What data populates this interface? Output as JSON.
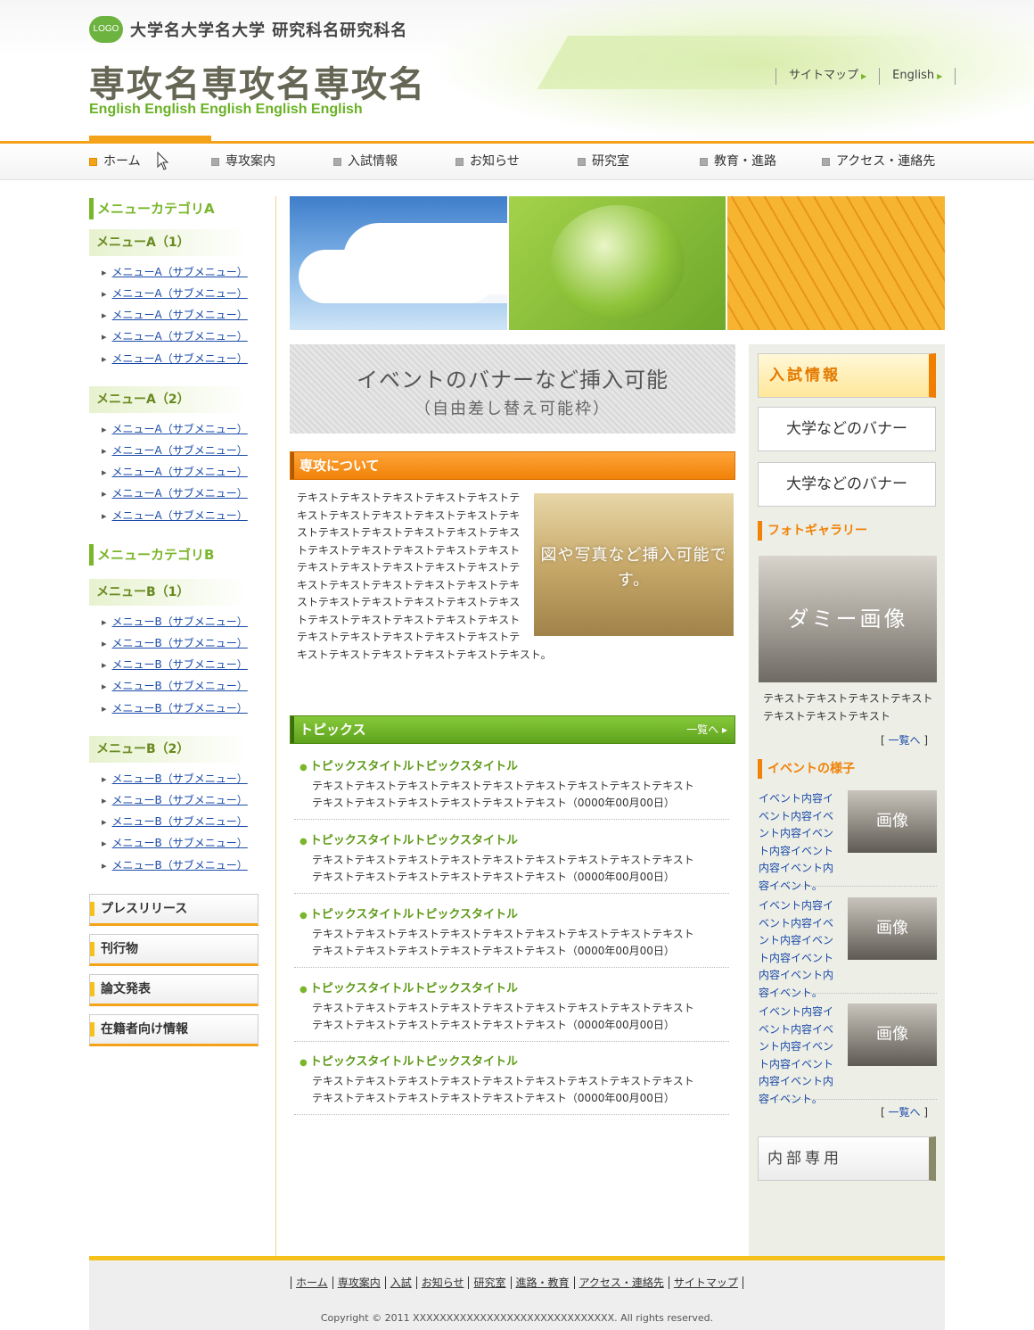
{
  "header": {
    "logo": "LOGO",
    "university": "大学名大学名大学 研究科名研究科名",
    "department": "専攻名専攻名専攻名",
    "department_en": "English English English English English",
    "toplinks": [
      "サイトマップ",
      "English"
    ]
  },
  "nav": {
    "items": [
      "ホーム",
      "専攻案内",
      "入試情報",
      "お知らせ",
      "研究室",
      "教育・進路",
      "アクセス・連絡先"
    ],
    "active": "ホーム"
  },
  "left": {
    "cat_a": "メニューカテゴリA",
    "cat_b": "メニューカテゴリB",
    "menu_a1": "メニューA（1）",
    "menu_a2": "メニューA（2）",
    "menu_b1": "メニューB（1）",
    "menu_b2": "メニューB（2）",
    "sub_a": "メニューA（サブメニュー）",
    "sub_b": "メニューB（サブメニュー）",
    "buttons": [
      "プレスリリース",
      "刊行物",
      "論文発表",
      "在籍者向け情報"
    ]
  },
  "main": {
    "event_banner": {
      "line1": "イベントのバナーなど挿入可能",
      "line2": "（自由差し替え可能枠）"
    },
    "about_title": "専攻について",
    "about_image_text": "図や写真など挿入可能です。",
    "about_text": "テキストテキストテキストテキストテキストテキストテキストテキストテキストテキストテキストテキストテキストテキストテキストテキストテキストテキストテキストテキストテキストテキストテキストテキストテキストテキストテキストテキストテキストテキストテキストテキストテキストテキストテキストテキストテキストテキストテキストテキストテキストテキストテキストテキストテキストテキストテキストテキストテキストテキストテキストテキストテキスト。",
    "topics_title": "トピックス",
    "topics_more": "一覧へ",
    "topic_title": "トピックスタイトルトピックスタイトル",
    "topic_line1": "テキストテキストテキストテキストテキストテキストテキストテキストテキスト",
    "topic_line2": "テキストテキストテキストテキストテキストテキスト（0000年00月00日）"
  },
  "right": {
    "nyushi": "入試情報",
    "banner1": "大学などのバナー",
    "banner2": "大学などのバナー",
    "gallery_title": "フォトギャラリー",
    "gallery_img": "ダミー画像",
    "gallery_caption": "テキストテキストテキストテキストテキストテキストテキスト",
    "more": "一覧へ",
    "events_title": "イベントの様子",
    "event_link": "イベント内容イベント内容イベント内容イベント内容イベント内容イベント内容イベント。",
    "event_img": "画像",
    "internal": "内部専用"
  },
  "footer": {
    "links": [
      "ホーム",
      "専攻案内",
      "入試",
      "お知らせ",
      "研究室",
      "進路・教育",
      "アクセス・連絡先",
      "サイトマップ"
    ],
    "copyright": "Copyright © 2011 XXXXXXXXXXXXXXXXXXXXXXXXXXXXXX. All rights reserved."
  },
  "colors": {
    "accent_orange": "#f08208",
    "accent_green": "#7ab62a",
    "accent_yellow": "#f4c21a"
  }
}
